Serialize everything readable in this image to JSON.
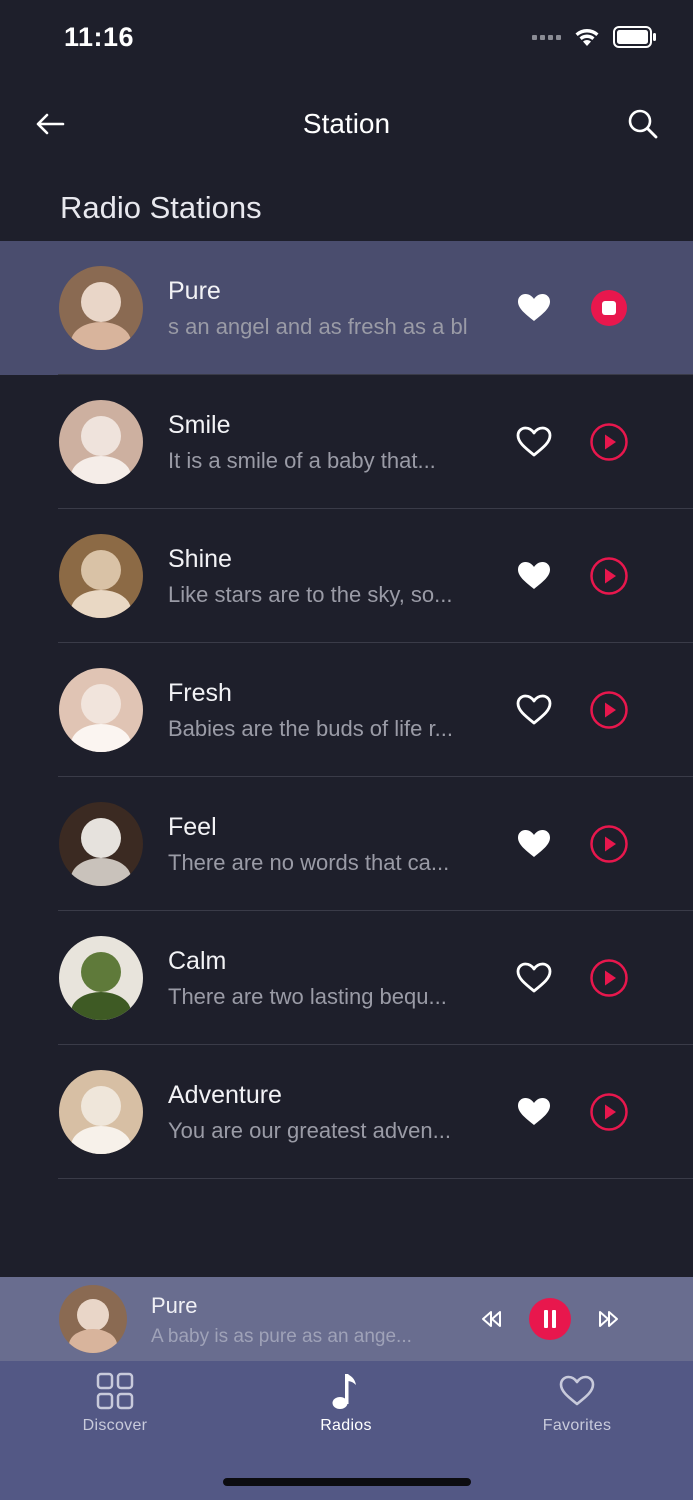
{
  "status_bar": {
    "time": "11:16"
  },
  "header": {
    "title": "Station"
  },
  "section": {
    "title": "Radio Stations"
  },
  "stations": [
    {
      "name": "Pure",
      "description": "s an angel and as fresh as a bl",
      "favorite": true,
      "state": "playing",
      "avatar_colors": [
        "#e9d6c8",
        "#8a6a52",
        "#d8b49c"
      ]
    },
    {
      "name": "Smile",
      "description": "It is a smile of a baby that...",
      "favorite": false,
      "state": "stopped",
      "avatar_colors": [
        "#efe3dc",
        "#cdb0a0",
        "#f5ede8"
      ]
    },
    {
      "name": "Shine",
      "description": "Like stars are to the sky, so...",
      "favorite": true,
      "state": "stopped",
      "avatar_colors": [
        "#d9c2a6",
        "#8c6a45",
        "#e9d8c4"
      ]
    },
    {
      "name": "Fresh",
      "description": "Babies are the buds of life r...",
      "favorite": false,
      "state": "stopped",
      "avatar_colors": [
        "#f1e4dc",
        "#e0c4b4",
        "#fbf5f1"
      ]
    },
    {
      "name": "Feel",
      "description": "There are no words that ca...",
      "favorite": true,
      "state": "stopped",
      "avatar_colors": [
        "#e6e2dd",
        "#3b2a22",
        "#c9c2bb"
      ]
    },
    {
      "name": "Calm",
      "description": "There are two lasting bequ...",
      "favorite": false,
      "state": "stopped",
      "avatar_colors": [
        "#5f7a3a",
        "#e8e4dc",
        "#3e5a24"
      ]
    },
    {
      "name": "Adventure",
      "description": "You are our greatest adven...",
      "favorite": true,
      "state": "stopped",
      "avatar_colors": [
        "#efe6da",
        "#d7bfa4",
        "#f7f1ea"
      ]
    }
  ],
  "mini_player": {
    "name": "Pure",
    "description": "A baby is as pure as an ange...",
    "state": "playing"
  },
  "tabs": [
    {
      "label": "Discover",
      "icon": "grid-icon",
      "active": false
    },
    {
      "label": "Radios",
      "icon": "music-note-icon",
      "active": true
    },
    {
      "label": "Favorites",
      "icon": "heart-outline-icon",
      "active": false
    }
  ],
  "colors": {
    "background": "#1e1f2b",
    "active_row": "#4a4d6e",
    "accent": "#e8174d",
    "mini_player": "#696d8f",
    "tab_bar": "#535885"
  }
}
